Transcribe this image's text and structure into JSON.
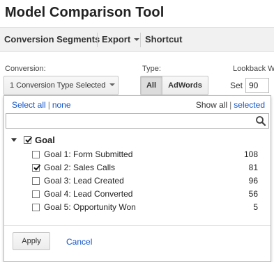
{
  "app": {
    "title": "Model Comparison Tool"
  },
  "toolbar": {
    "items": [
      {
        "label": "Conversion Segments"
      },
      {
        "label": "Export"
      },
      {
        "label": "Shortcut"
      }
    ]
  },
  "filters": {
    "conversion_label": "Conversion:",
    "conversion_value": "1 Conversion Type Selected",
    "type_label": "Type:",
    "type_options": [
      "All",
      "AdWords"
    ],
    "type_selected": "All",
    "lookback_label": "Lookback W",
    "set_label": "Set",
    "lookback_value": "90"
  },
  "dropdown": {
    "select_all": "Select all",
    "select_none": "none",
    "show_all": "Show all",
    "show_selected": "selected",
    "search_placeholder": "",
    "group": {
      "label": "Goal",
      "checked": true,
      "expanded": true
    },
    "goals": [
      {
        "label": "Goal 1: Form Submitted",
        "count": "108",
        "checked": false
      },
      {
        "label": "Goal 2: Sales Calls",
        "count": "81",
        "checked": true
      },
      {
        "label": "Goal 3: Lead Created",
        "count": "96",
        "checked": false
      },
      {
        "label": "Goal 4: Lead Converted",
        "count": "56",
        "checked": false
      },
      {
        "label": "Goal 5: Opportunity Won",
        "count": "5",
        "checked": false
      }
    ],
    "apply_label": "Apply",
    "cancel_label": "Cancel"
  },
  "colors": {
    "link": "#1155cc",
    "toolbar_bg": "#f1f1f1"
  },
  "icons": {
    "search": "search-icon",
    "check": "checkmark-icon",
    "expand": "triangle-down-icon"
  }
}
